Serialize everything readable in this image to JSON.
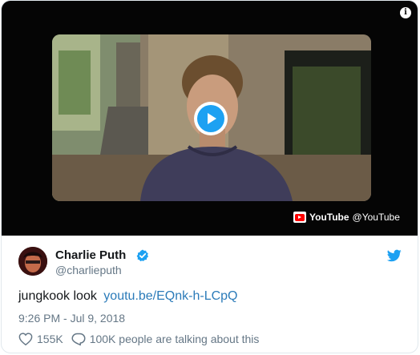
{
  "media": {
    "info_icon": "info-icon",
    "play_icon": "play-icon",
    "video_provider": "YouTube",
    "video_provider_handle": "@YouTube"
  },
  "author": {
    "display_name": "Charlie Puth",
    "handle": "@charlieputh",
    "verified_icon": "verified-badge-icon"
  },
  "brand_icon": "twitter-bird-icon",
  "tweet": {
    "text": "jungkook look",
    "link": "youtu.be/EQnk-h-LCpQ",
    "timestamp": "9:26 PM - Jul 9, 2018"
  },
  "actions": {
    "likes": "155K",
    "talking": "100K people are talking about this"
  },
  "colors": {
    "link": "#2b7bb9",
    "accent": "#1da1f2",
    "muted": "#657786",
    "youtube_red": "#ff0000"
  }
}
